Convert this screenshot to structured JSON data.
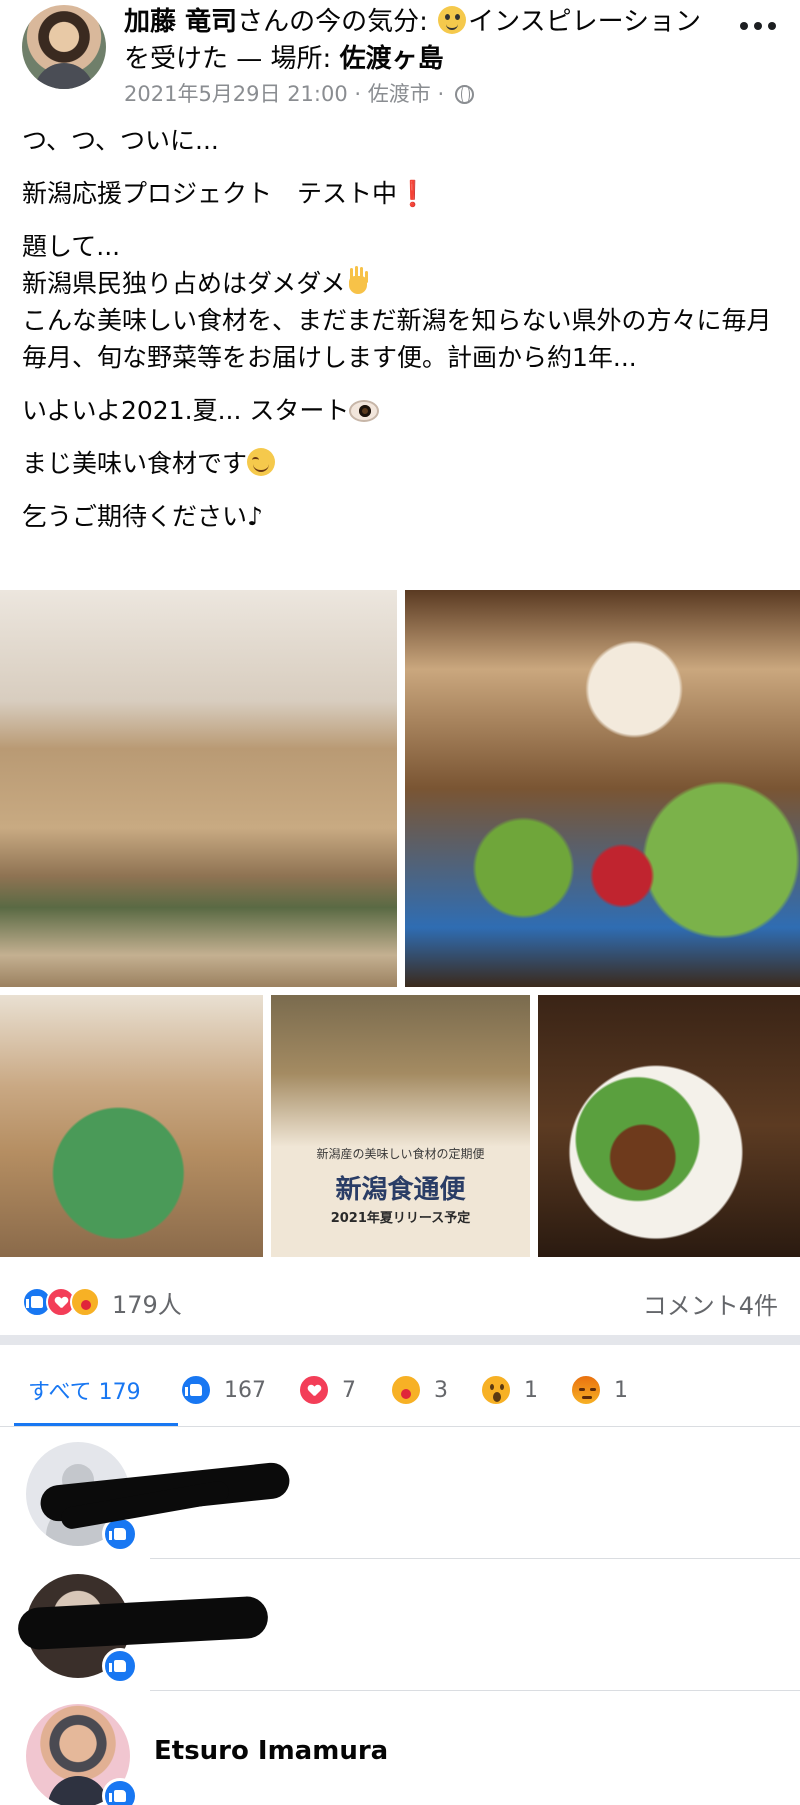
{
  "header": {
    "author": "加藤 竜司",
    "feeling_prefix": "さんの今の気分:",
    "feeling": "インスピレーションを受けた",
    "location_sep": "— 場所:",
    "location": "佐渡ヶ島",
    "timestamp": "2021年5月29日 21:00",
    "place": "佐渡市",
    "dot": "·"
  },
  "post": {
    "line1": "つ、つ、ついに...",
    "line2": "新潟応援プロジェクト　テスト中",
    "line2_mark": "❗",
    "line3a": "題して...",
    "line3b": "新潟県民独り占めはダメダメ",
    "line3c": "こんな美味しい食材を、まだまだ新潟を知らない県外の方々に毎月毎月、旬な野菜等をお届けします便。計画から約1年...",
    "line4": "いよいよ2021.夏... スタート",
    "line5": "まじ美味い食材です",
    "line6": "乞うご期待ください♪"
  },
  "photos": {
    "flyer_sub": "新潟産の美味しい食材の定期便",
    "flyer_title": "新潟食通便",
    "flyer_date": "2021年夏リリース予定"
  },
  "reactions": {
    "summary_count": "179人",
    "comment_count": "コメント4件",
    "tabs": {
      "all_label": "すべて 179",
      "like": "167",
      "love": "7",
      "care": "3",
      "wow": "1",
      "angry": "1"
    }
  },
  "reactors": [
    {
      "name": ""
    },
    {
      "name": ""
    },
    {
      "name": "Etsuro Imamura"
    }
  ],
  "colors": {
    "accent": "#1877f2",
    "love": "#f33e58",
    "care": "#f7b125",
    "text_secondary": "#65676b"
  },
  "icons": [
    "globe-icon",
    "more-icon",
    "like-icon",
    "love-icon",
    "care-icon",
    "wow-icon",
    "angry-icon"
  ]
}
